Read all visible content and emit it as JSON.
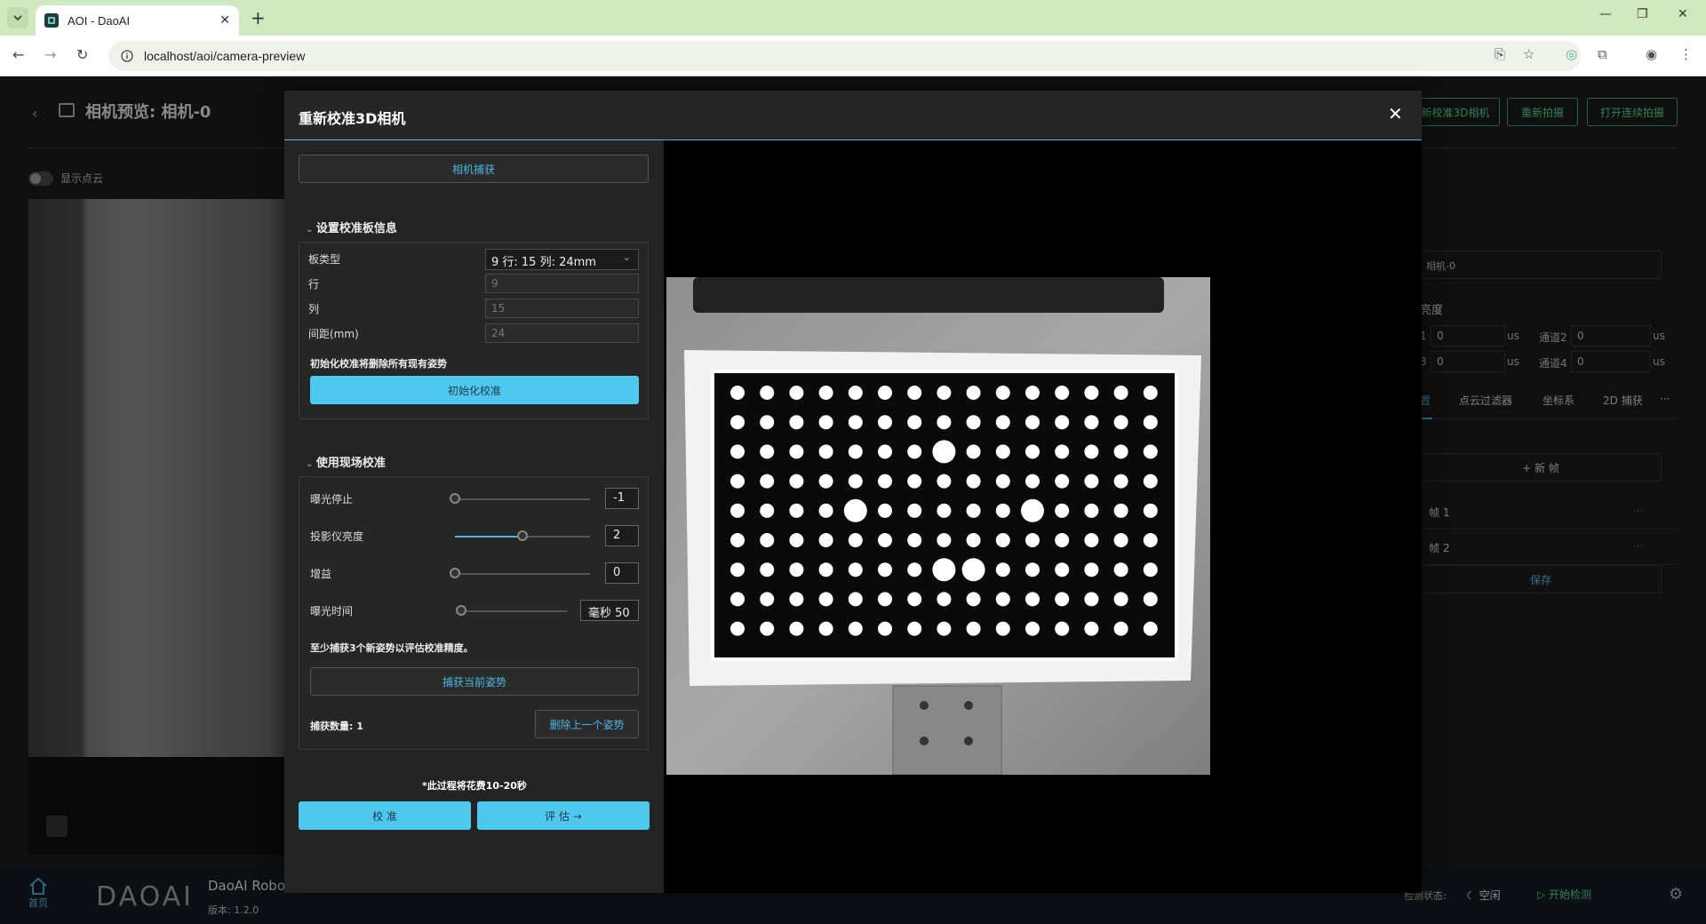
{
  "browser": {
    "tab_title": "AOI - DaoAI",
    "url": "localhost/aoi/camera-preview"
  },
  "app": {
    "page_title": "相机预览: 相机-0",
    "top_buttons": [
      "新校准3D相机",
      "重新拍摄",
      "打开连续拍摄"
    ],
    "show_pointcloud": "显示点云",
    "right_panel": {
      "camera_select": "相机-0",
      "brightness_label": "亮度",
      "channels": [
        {
          "prefix": "1",
          "value": "0",
          "unit": "us"
        },
        {
          "label": "通道2",
          "value": "0",
          "unit": "us"
        },
        {
          "prefix": "3",
          "value": "0",
          "unit": "us"
        },
        {
          "label": "通道4",
          "value": "0",
          "unit": "us"
        }
      ],
      "tabs": [
        "置",
        "点云过滤器",
        "坐标系",
        "2D 捕获",
        "···"
      ],
      "new_frame": "+ 新 帧",
      "frames": [
        "帧 1",
        "帧 2"
      ],
      "frame_more": "···",
      "save": "保存"
    },
    "footer": {
      "home_label": "首页",
      "logo": "DAOAI",
      "app_name": "DaoAI Robo",
      "version": "版本: 1.2.0",
      "status_label": "检测状态:",
      "status_value": "空闲",
      "start_detection": "开始检测"
    }
  },
  "modal": {
    "title": "重新校准3D相机",
    "capture_button": "相机捕获",
    "board_section": {
      "title": "设置校准板信息",
      "board_type_label": "板类型",
      "board_type_value": "9 行: 15 列: 24mm",
      "rows_label": "行",
      "rows_value": "9",
      "cols_label": "列",
      "cols_value": "15",
      "spacing_label": "间距(mm)",
      "spacing_value": "24",
      "warning": "初始化校准将删除所有现有姿势",
      "init_button": "初始化校准"
    },
    "field_section": {
      "title": "使用现场校准",
      "sliders": [
        {
          "label": "曝光停止",
          "value": "-1",
          "level": 0.0
        },
        {
          "label": "投影仪亮度",
          "value": "2",
          "level": 0.5
        },
        {
          "label": "增益",
          "value": "0",
          "level": 0.0
        },
        {
          "label": "曝光时间",
          "value": "毫秒 50",
          "level": 0.0
        }
      ],
      "hint": "至少捕获3个新姿势以评估校准精度。",
      "capture_pose_button": "捕获当前姿势",
      "capture_count": "捕获数量: 1",
      "delete_last_button": "删除上一个姿势"
    },
    "note": "*此过程将花费10-20秒",
    "calibrate_button": "校 准",
    "evaluate_button": "评 估 →"
  }
}
